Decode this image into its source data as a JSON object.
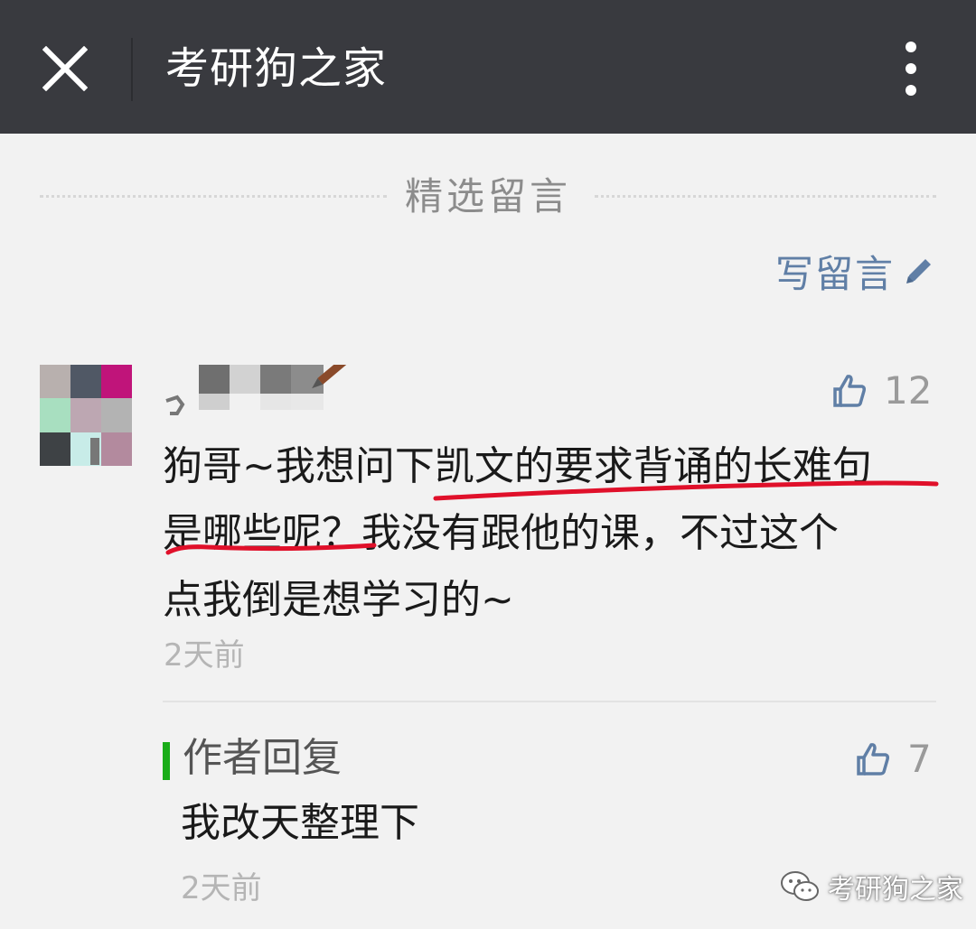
{
  "topbar": {
    "title": "考研狗之家",
    "close_icon": "close-icon",
    "more_icon": "more-vertical-icon"
  },
  "section": {
    "title": "精选留言"
  },
  "write_comment": {
    "label": "写留言",
    "icon": "pencil-icon"
  },
  "comment": {
    "avatar": "pixelated-avatar",
    "likes": "12",
    "lines": [
      "狗哥~我想问下凯文的要求背诵的长难句",
      "是哪些呢？我没有跟他的课，不过这个",
      "点我倒是想学习的~"
    ],
    "time": "2天前"
  },
  "author_reply": {
    "label": "作者回复",
    "likes": "7",
    "text": "我改天整理下",
    "time": "2天前"
  },
  "watermark": {
    "text": "考研狗之家",
    "icon": "wechat-icon"
  },
  "colors": {
    "topbar_bg": "#393a3f",
    "page_bg": "#f2f2f2",
    "link_blue": "#607fa6",
    "reply_green": "#1aad19",
    "annotation_red": "#e0102a"
  }
}
